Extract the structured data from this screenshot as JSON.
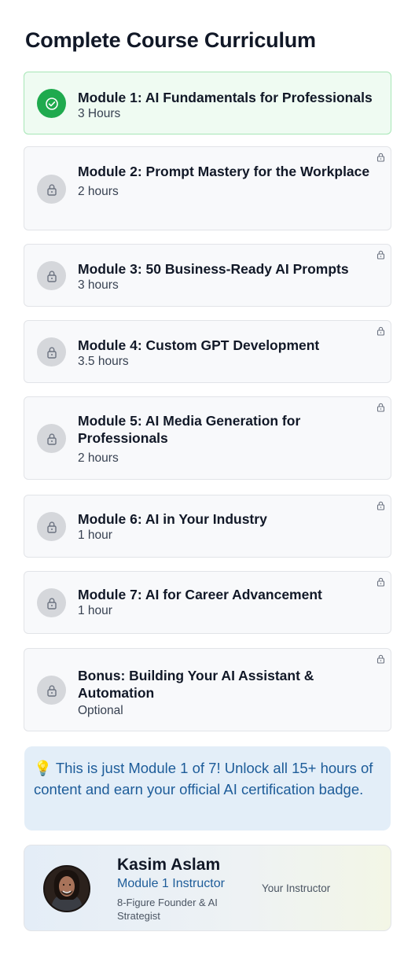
{
  "page": {
    "title": "Complete Course Curriculum"
  },
  "modules": [
    {
      "title": "Module 1: AI Fundamentals for Professionals",
      "duration": "3 Hours",
      "status": "completed"
    },
    {
      "title": "Module 2: Prompt Mastery for the Workplace",
      "duration": "2 hours",
      "status": "locked"
    },
    {
      "title": "Module 3: 50 Business-Ready AI Prompts",
      "duration": "3 hours",
      "status": "locked"
    },
    {
      "title": "Module 4: Custom GPT Development",
      "duration": "3.5 hours",
      "status": "locked"
    },
    {
      "title": "Module 5: AI Media Generation for Professionals",
      "duration": "2 hours",
      "status": "locked"
    },
    {
      "title": "Module 6: AI in Your Industry",
      "duration": "1 hour",
      "status": "locked"
    },
    {
      "title": "Module 7: AI for Career Advancement",
      "duration": "1 hour",
      "status": "locked"
    },
    {
      "title": "Bonus: Building Your AI Assistant & Automation",
      "duration": "Optional",
      "status": "locked"
    }
  ],
  "note": {
    "icon": "lightbulb-icon",
    "text": "💡 This is just Module 1 of 7! Unlock all 15+ hours of content and earn your official AI certification badge."
  },
  "instructor": {
    "name": "Kasim Aslam",
    "role": "Module 1 Instructor",
    "bio": "8-Figure Founder & AI Strategist",
    "label": "Your Instructor"
  },
  "colors": {
    "completed": "#1faa4e",
    "accent": "#1d5c99",
    "locked": "#d5d7db"
  }
}
